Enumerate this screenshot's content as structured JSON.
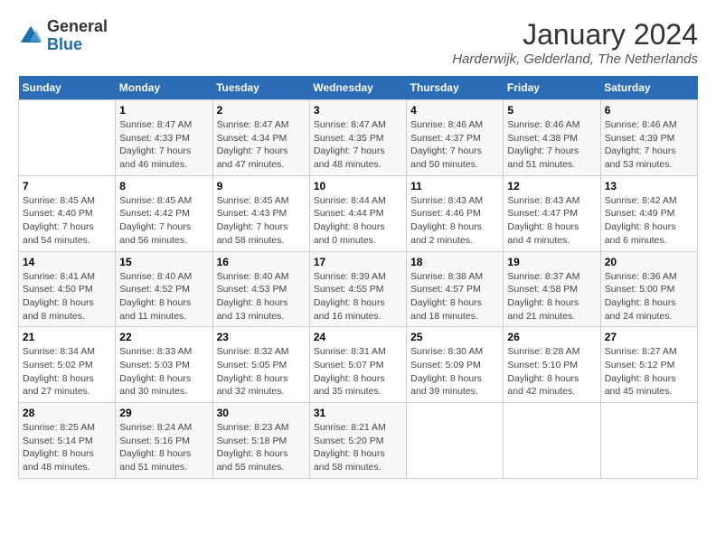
{
  "header": {
    "logo_general": "General",
    "logo_blue": "Blue",
    "month_title": "January 2024",
    "location": "Harderwijk, Gelderland, The Netherlands"
  },
  "calendar": {
    "days_of_week": [
      "Sunday",
      "Monday",
      "Tuesday",
      "Wednesday",
      "Thursday",
      "Friday",
      "Saturday"
    ],
    "weeks": [
      [
        {
          "day": "",
          "sunrise": "",
          "sunset": "",
          "daylight": ""
        },
        {
          "day": "1",
          "sunrise": "Sunrise: 8:47 AM",
          "sunset": "Sunset: 4:33 PM",
          "daylight": "Daylight: 7 hours and 46 minutes."
        },
        {
          "day": "2",
          "sunrise": "Sunrise: 8:47 AM",
          "sunset": "Sunset: 4:34 PM",
          "daylight": "Daylight: 7 hours and 47 minutes."
        },
        {
          "day": "3",
          "sunrise": "Sunrise: 8:47 AM",
          "sunset": "Sunset: 4:35 PM",
          "daylight": "Daylight: 7 hours and 48 minutes."
        },
        {
          "day": "4",
          "sunrise": "Sunrise: 8:46 AM",
          "sunset": "Sunset: 4:37 PM",
          "daylight": "Daylight: 7 hours and 50 minutes."
        },
        {
          "day": "5",
          "sunrise": "Sunrise: 8:46 AM",
          "sunset": "Sunset: 4:38 PM",
          "daylight": "Daylight: 7 hours and 51 minutes."
        },
        {
          "day": "6",
          "sunrise": "Sunrise: 8:46 AM",
          "sunset": "Sunset: 4:39 PM",
          "daylight": "Daylight: 7 hours and 53 minutes."
        }
      ],
      [
        {
          "day": "7",
          "sunrise": "Sunrise: 8:45 AM",
          "sunset": "Sunset: 4:40 PM",
          "daylight": "Daylight: 7 hours and 54 minutes."
        },
        {
          "day": "8",
          "sunrise": "Sunrise: 8:45 AM",
          "sunset": "Sunset: 4:42 PM",
          "daylight": "Daylight: 7 hours and 56 minutes."
        },
        {
          "day": "9",
          "sunrise": "Sunrise: 8:45 AM",
          "sunset": "Sunset: 4:43 PM",
          "daylight": "Daylight: 7 hours and 58 minutes."
        },
        {
          "day": "10",
          "sunrise": "Sunrise: 8:44 AM",
          "sunset": "Sunset: 4:44 PM",
          "daylight": "Daylight: 8 hours and 0 minutes."
        },
        {
          "day": "11",
          "sunrise": "Sunrise: 8:43 AM",
          "sunset": "Sunset: 4:46 PM",
          "daylight": "Daylight: 8 hours and 2 minutes."
        },
        {
          "day": "12",
          "sunrise": "Sunrise: 8:43 AM",
          "sunset": "Sunset: 4:47 PM",
          "daylight": "Daylight: 8 hours and 4 minutes."
        },
        {
          "day": "13",
          "sunrise": "Sunrise: 8:42 AM",
          "sunset": "Sunset: 4:49 PM",
          "daylight": "Daylight: 8 hours and 6 minutes."
        }
      ],
      [
        {
          "day": "14",
          "sunrise": "Sunrise: 8:41 AM",
          "sunset": "Sunset: 4:50 PM",
          "daylight": "Daylight: 8 hours and 8 minutes."
        },
        {
          "day": "15",
          "sunrise": "Sunrise: 8:40 AM",
          "sunset": "Sunset: 4:52 PM",
          "daylight": "Daylight: 8 hours and 11 minutes."
        },
        {
          "day": "16",
          "sunrise": "Sunrise: 8:40 AM",
          "sunset": "Sunset: 4:53 PM",
          "daylight": "Daylight: 8 hours and 13 minutes."
        },
        {
          "day": "17",
          "sunrise": "Sunrise: 8:39 AM",
          "sunset": "Sunset: 4:55 PM",
          "daylight": "Daylight: 8 hours and 16 minutes."
        },
        {
          "day": "18",
          "sunrise": "Sunrise: 8:38 AM",
          "sunset": "Sunset: 4:57 PM",
          "daylight": "Daylight: 8 hours and 18 minutes."
        },
        {
          "day": "19",
          "sunrise": "Sunrise: 8:37 AM",
          "sunset": "Sunset: 4:58 PM",
          "daylight": "Daylight: 8 hours and 21 minutes."
        },
        {
          "day": "20",
          "sunrise": "Sunrise: 8:36 AM",
          "sunset": "Sunset: 5:00 PM",
          "daylight": "Daylight: 8 hours and 24 minutes."
        }
      ],
      [
        {
          "day": "21",
          "sunrise": "Sunrise: 8:34 AM",
          "sunset": "Sunset: 5:02 PM",
          "daylight": "Daylight: 8 hours and 27 minutes."
        },
        {
          "day": "22",
          "sunrise": "Sunrise: 8:33 AM",
          "sunset": "Sunset: 5:03 PM",
          "daylight": "Daylight: 8 hours and 30 minutes."
        },
        {
          "day": "23",
          "sunrise": "Sunrise: 8:32 AM",
          "sunset": "Sunset: 5:05 PM",
          "daylight": "Daylight: 8 hours and 32 minutes."
        },
        {
          "day": "24",
          "sunrise": "Sunrise: 8:31 AM",
          "sunset": "Sunset: 5:07 PM",
          "daylight": "Daylight: 8 hours and 35 minutes."
        },
        {
          "day": "25",
          "sunrise": "Sunrise: 8:30 AM",
          "sunset": "Sunset: 5:09 PM",
          "daylight": "Daylight: 8 hours and 39 minutes."
        },
        {
          "day": "26",
          "sunrise": "Sunrise: 8:28 AM",
          "sunset": "Sunset: 5:10 PM",
          "daylight": "Daylight: 8 hours and 42 minutes."
        },
        {
          "day": "27",
          "sunrise": "Sunrise: 8:27 AM",
          "sunset": "Sunset: 5:12 PM",
          "daylight": "Daylight: 8 hours and 45 minutes."
        }
      ],
      [
        {
          "day": "28",
          "sunrise": "Sunrise: 8:25 AM",
          "sunset": "Sunset: 5:14 PM",
          "daylight": "Daylight: 8 hours and 48 minutes."
        },
        {
          "day": "29",
          "sunrise": "Sunrise: 8:24 AM",
          "sunset": "Sunset: 5:16 PM",
          "daylight": "Daylight: 8 hours and 51 minutes."
        },
        {
          "day": "30",
          "sunrise": "Sunrise: 8:23 AM",
          "sunset": "Sunset: 5:18 PM",
          "daylight": "Daylight: 8 hours and 55 minutes."
        },
        {
          "day": "31",
          "sunrise": "Sunrise: 8:21 AM",
          "sunset": "Sunset: 5:20 PM",
          "daylight": "Daylight: 8 hours and 58 minutes."
        },
        {
          "day": "",
          "sunrise": "",
          "sunset": "",
          "daylight": ""
        },
        {
          "day": "",
          "sunrise": "",
          "sunset": "",
          "daylight": ""
        },
        {
          "day": "",
          "sunrise": "",
          "sunset": "",
          "daylight": ""
        }
      ]
    ]
  }
}
